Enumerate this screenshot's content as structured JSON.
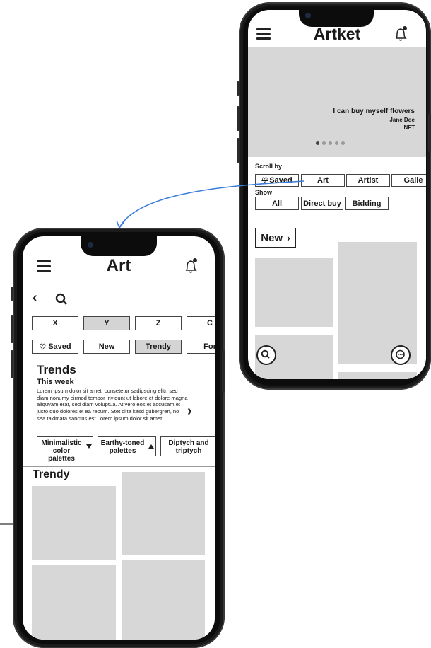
{
  "phone_right": {
    "app_title": "Artket",
    "hero": {
      "title": "I can buy myself flowers",
      "artist": "Jane Doe",
      "type": "NFT",
      "slides": 5,
      "active_slide": 1
    },
    "scroll_by_label": "Scroll by",
    "scroll_by_chips": [
      "Saved",
      "Art",
      "Artist",
      "Galle"
    ],
    "show_label": "Show",
    "show_chips": [
      "All",
      "Direct buy",
      "Bidding"
    ],
    "new_button": "New",
    "icons": {
      "menu": "hamburger-menu-icon",
      "notifications": "bell-icon",
      "search": "search-icon",
      "chat": "chat-icon"
    }
  },
  "phone_left": {
    "app_title": "Art",
    "filter_letters": [
      "X",
      "Y",
      "Z",
      "C"
    ],
    "selected_letter": "Y",
    "filter_chips": [
      "Saved",
      "New",
      "Trendy",
      "For"
    ],
    "selected_chip": "Trendy",
    "trends_title": "Trends",
    "trends_subtitle": "This week",
    "trends_body": "Lorem ipsum dolor sit amet, consetetur sadipscing elitr, sed diam nonumy eirmod tempor invidunt ut labore et dolore magna aliquyam erat, sed diam voluptua. At vero eos et accusam et justo duo dolores et ea rebum. Stet clita kasd gubergren, no sea takimata sanctus est Lorem ipsum dolor sit amet.",
    "palettes": [
      "Minimalistic color palettes",
      "Earthy-toned palettes",
      "Diptych and triptych"
    ],
    "trendy_heading": "Trendy",
    "icons": {
      "back": "chevron-left-icon",
      "search": "search-icon",
      "next": "chevron-right-icon"
    }
  },
  "colors": {
    "connector": "#3b7dd8",
    "placeholder": "#d7d7d7",
    "selected_chip": "#d4d4d4"
  }
}
